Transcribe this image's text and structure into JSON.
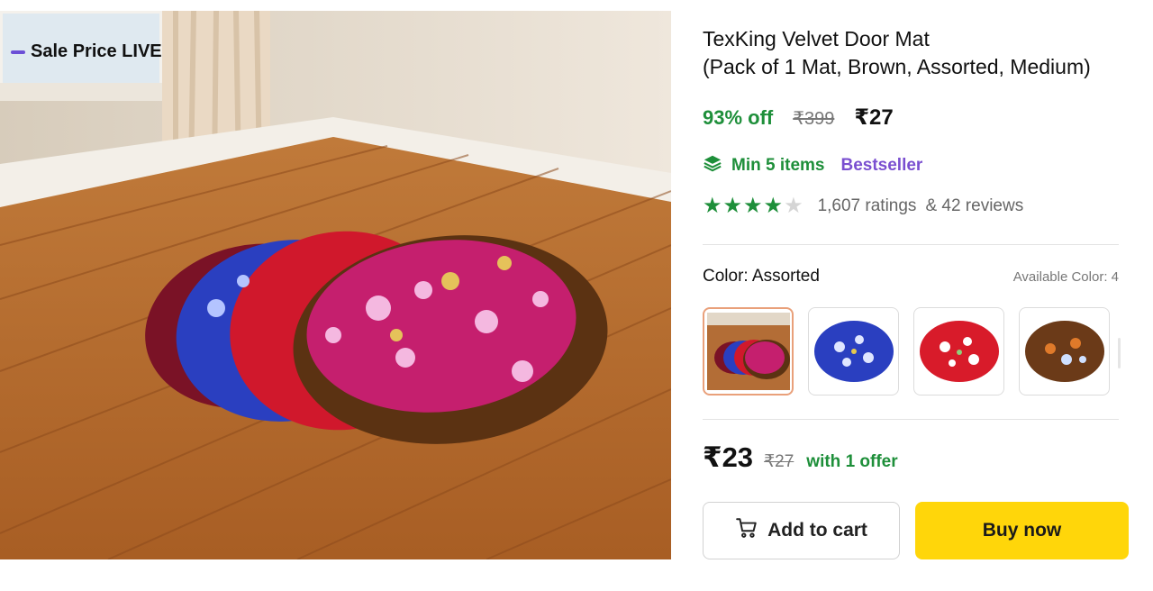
{
  "image": {
    "badge_text": "Sale Price LIVE",
    "alt": "Velvet door mats in assorted floral colors stacked on a wooden floor"
  },
  "product": {
    "title_line1": "TexKing Velvet Door Mat",
    "title_line2": "(Pack of 1 Mat, Brown, Assorted, Medium)"
  },
  "pricing": {
    "discount": "93% off",
    "mrp": "₹399",
    "price": "₹27"
  },
  "promo": {
    "icon": "stack-layers-icon",
    "min_items": "Min 5 items",
    "badge": "Bestseller"
  },
  "rating": {
    "stars": 4,
    "max_stars": 5,
    "ratings_text": "1,607 ratings",
    "reviews_text": "& 42 reviews"
  },
  "color": {
    "label": "Color: Assorted",
    "available": "Available Color: 4",
    "swatches": [
      {
        "name": "Assorted",
        "selected": true
      },
      {
        "name": "Blue",
        "selected": false
      },
      {
        "name": "Red",
        "selected": false
      },
      {
        "name": "Brown",
        "selected": false
      }
    ]
  },
  "offer": {
    "price": "₹23",
    "mrp": "₹27",
    "text": "with 1 offer"
  },
  "actions": {
    "add_to_cart": "Add to cart",
    "buy_now": "Buy now"
  },
  "colors": {
    "green": "#1e8f3a",
    "purple": "#7a4fd0",
    "buy_button": "#ffd60a",
    "selected_border": "#e9a07a"
  }
}
